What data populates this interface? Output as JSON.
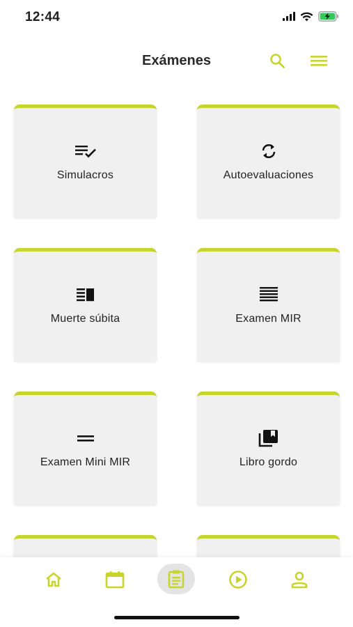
{
  "status_bar": {
    "time": "12:44",
    "icons": [
      "signal-icon",
      "wifi-icon",
      "battery-charging-icon"
    ]
  },
  "header": {
    "title": "Exámenes",
    "actions": [
      "search-icon",
      "menu-icon"
    ]
  },
  "accent_color": "#c8d42e",
  "cards": [
    {
      "label": "Simulacros",
      "icon": "checklist-icon"
    },
    {
      "label": "Autoevaluaciones",
      "icon": "refresh-icon"
    },
    {
      "label": "Muerte súbita",
      "icon": "split-view-icon"
    },
    {
      "label": "Examen MIR",
      "icon": "list-lines-icon"
    },
    {
      "label": "Examen Mini MIR",
      "icon": "equals-icon"
    },
    {
      "label": "Libro gordo",
      "icon": "bookmark-library-icon"
    }
  ],
  "bottom_nav": {
    "items": [
      "home-icon",
      "calendar-icon",
      "clipboard-icon",
      "play-icon",
      "profile-icon"
    ],
    "active": "clipboard-icon"
  }
}
